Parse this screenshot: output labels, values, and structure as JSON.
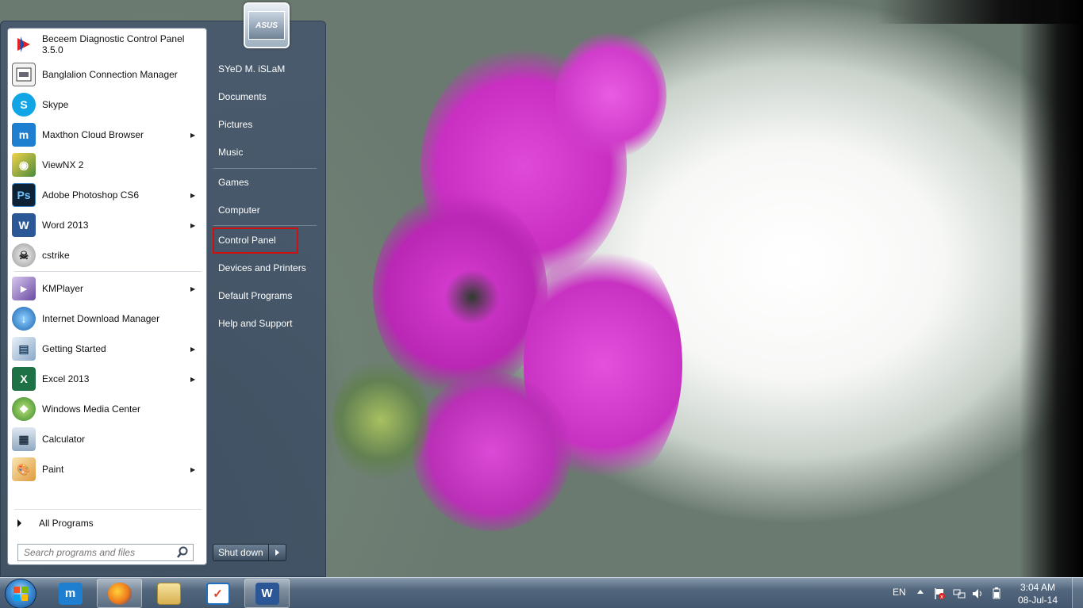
{
  "programs": [
    {
      "label": "Beceem Diagnostic Control Panel 3.5.0",
      "icon": "beceem-icon",
      "submenu": false
    },
    {
      "label": "Banglalion Connection Manager",
      "icon": "banglalion-icon",
      "submenu": false
    },
    {
      "label": "Skype",
      "icon": "skype-icon",
      "submenu": false
    },
    {
      "label": "Maxthon Cloud Browser",
      "icon": "maxthon-icon",
      "submenu": true
    },
    {
      "label": "ViewNX 2",
      "icon": "viewnx-icon",
      "submenu": false
    },
    {
      "label": "Adobe Photoshop CS6",
      "icon": "photoshop-icon",
      "submenu": true
    },
    {
      "label": "Word 2013",
      "icon": "word-icon",
      "submenu": true
    },
    {
      "label": "cstrike",
      "icon": "cstrike-icon",
      "submenu": false
    },
    {
      "label": "KMPlayer",
      "icon": "kmplayer-icon",
      "submenu": true
    },
    {
      "label": "Internet Download Manager",
      "icon": "idm-icon",
      "submenu": false
    },
    {
      "label": "Getting Started",
      "icon": "getting-started-icon",
      "submenu": true
    },
    {
      "label": "Excel 2013",
      "icon": "excel-icon",
      "submenu": true
    },
    {
      "label": "Windows Media Center",
      "icon": "media-center-icon",
      "submenu": false
    },
    {
      "label": "Calculator",
      "icon": "calculator-icon",
      "submenu": false
    },
    {
      "label": "Paint",
      "icon": "paint-icon",
      "submenu": true
    }
  ],
  "all_programs": "All Programs",
  "search": {
    "placeholder": "Search programs and files",
    "value": ""
  },
  "right_pane": {
    "user": "SYeD M. iSLaM",
    "documents": "Documents",
    "pictures": "Pictures",
    "music": "Music",
    "games": "Games",
    "computer": "Computer",
    "control_panel": "Control Panel",
    "devices": "Devices and Printers",
    "default_programs": "Default Programs",
    "help": "Help and Support"
  },
  "user_picture_text": "ASUS",
  "shutdown": "Shut down",
  "taskbar": {
    "pinned": [
      "start-orb",
      "maxthon-icon",
      "firefox-icon",
      "explorer-icon",
      "todo-icon",
      "word-icon"
    ],
    "language": "EN",
    "time": "3:04 AM",
    "date": "08-Jul-14"
  },
  "colors": {
    "highlight": "#d01010",
    "menu_bg": "#46586c",
    "taskbar": "#4a5f76"
  }
}
